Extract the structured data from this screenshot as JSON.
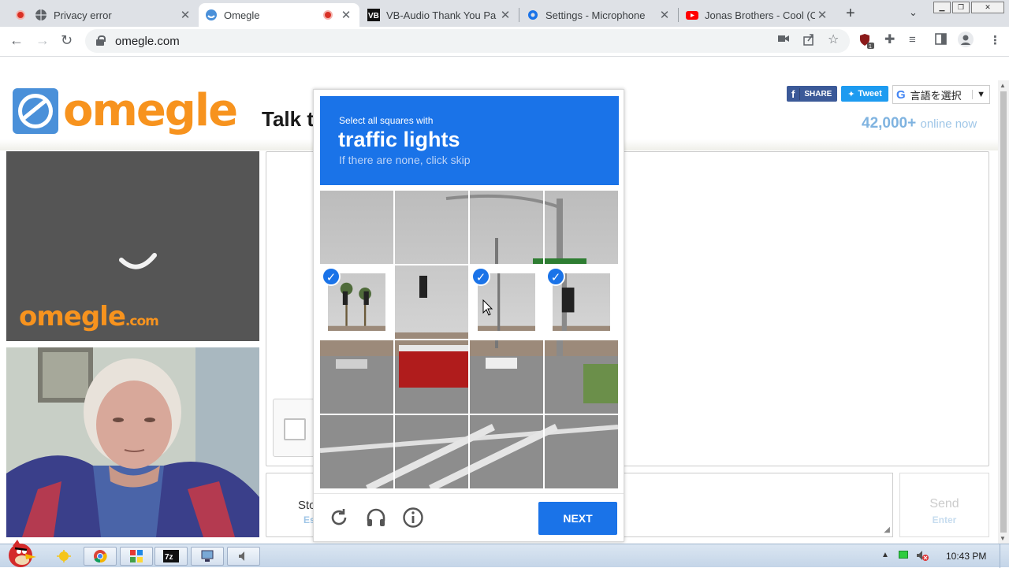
{
  "browser": {
    "tabs": [
      {
        "title": "Privacy error",
        "recording": true
      },
      {
        "title": "Omegle",
        "recording": true,
        "active": true
      },
      {
        "title": "VB-Audio Thank You Pa"
      },
      {
        "title": "Settings - Microphone"
      },
      {
        "title": "Jonas Brothers - Cool (C"
      }
    ],
    "url": "omegle.com"
  },
  "omegle": {
    "logo": "omegle",
    "tagline": "Talk t",
    "share_label": "SHARE",
    "tweet_label": "Tweet",
    "translate_label": "言語を選択",
    "online_count": "42,000+",
    "online_suffix": "online now",
    "video_logo": "omegle",
    "video_logo_suffix": ".com",
    "stop_label": "Sto",
    "stop_key": "Es",
    "send_label": "Send",
    "send_key": "Enter"
  },
  "captcha": {
    "instruction": "Select all squares with",
    "target": "traffic lights",
    "hint": "If there are none, click skip",
    "selected_cells": [
      4,
      6,
      7
    ],
    "next_label": "NEXT",
    "colors": {
      "accent": "#1a73e8"
    }
  },
  "taskbar": {
    "items": [
      "folder-icon",
      "chrome-icon",
      "colors-icon",
      "7zip-icon",
      "network-icon",
      "audio-icon"
    ],
    "time": "10:43 PM"
  }
}
